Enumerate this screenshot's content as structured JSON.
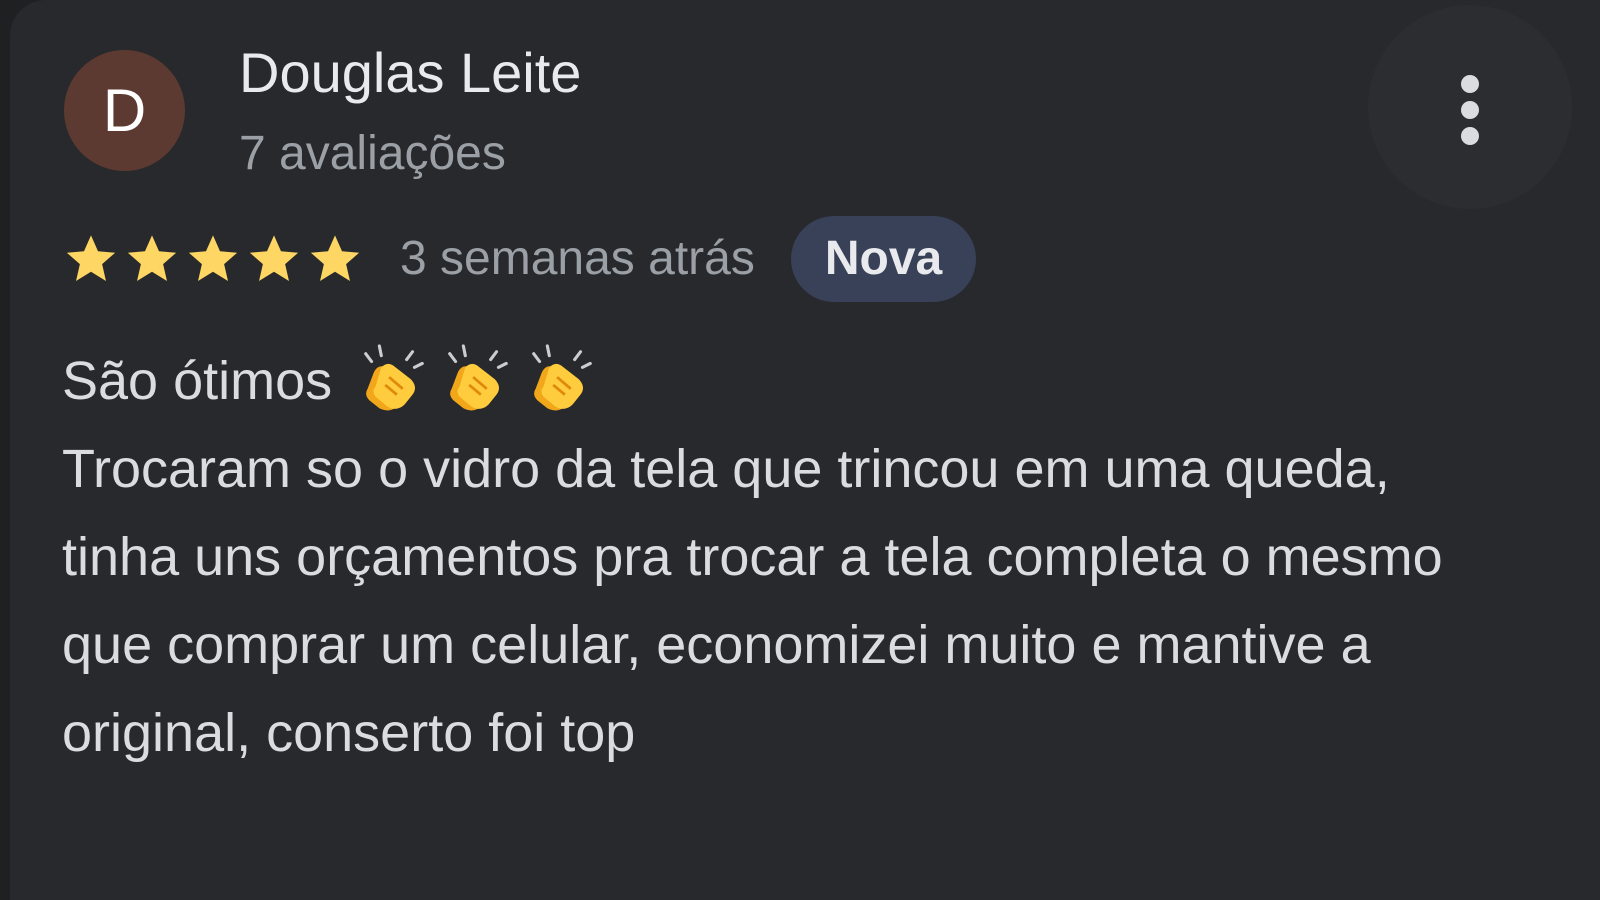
{
  "review": {
    "author": {
      "initial": "D",
      "name": "Douglas Leite",
      "review_count": "7 avaliações",
      "avatar_color": "#5c3a31"
    },
    "rating": 5,
    "star_color": "#fdd663",
    "time_ago": "3 semanas atrás",
    "badge": "Nova",
    "title_text": "São ótimos",
    "title_icons": [
      "clapping-hands-icon",
      "clapping-hands-icon",
      "clapping-hands-icon"
    ],
    "body": "Trocaram so o vidro da tela que trincou em uma queda, tinha uns orçamentos pra trocar a tela completa o mesmo que comprar um celular, economizei muito e mantive a original, conserto foi top"
  },
  "menu": {
    "icon": "more-vert-icon"
  }
}
